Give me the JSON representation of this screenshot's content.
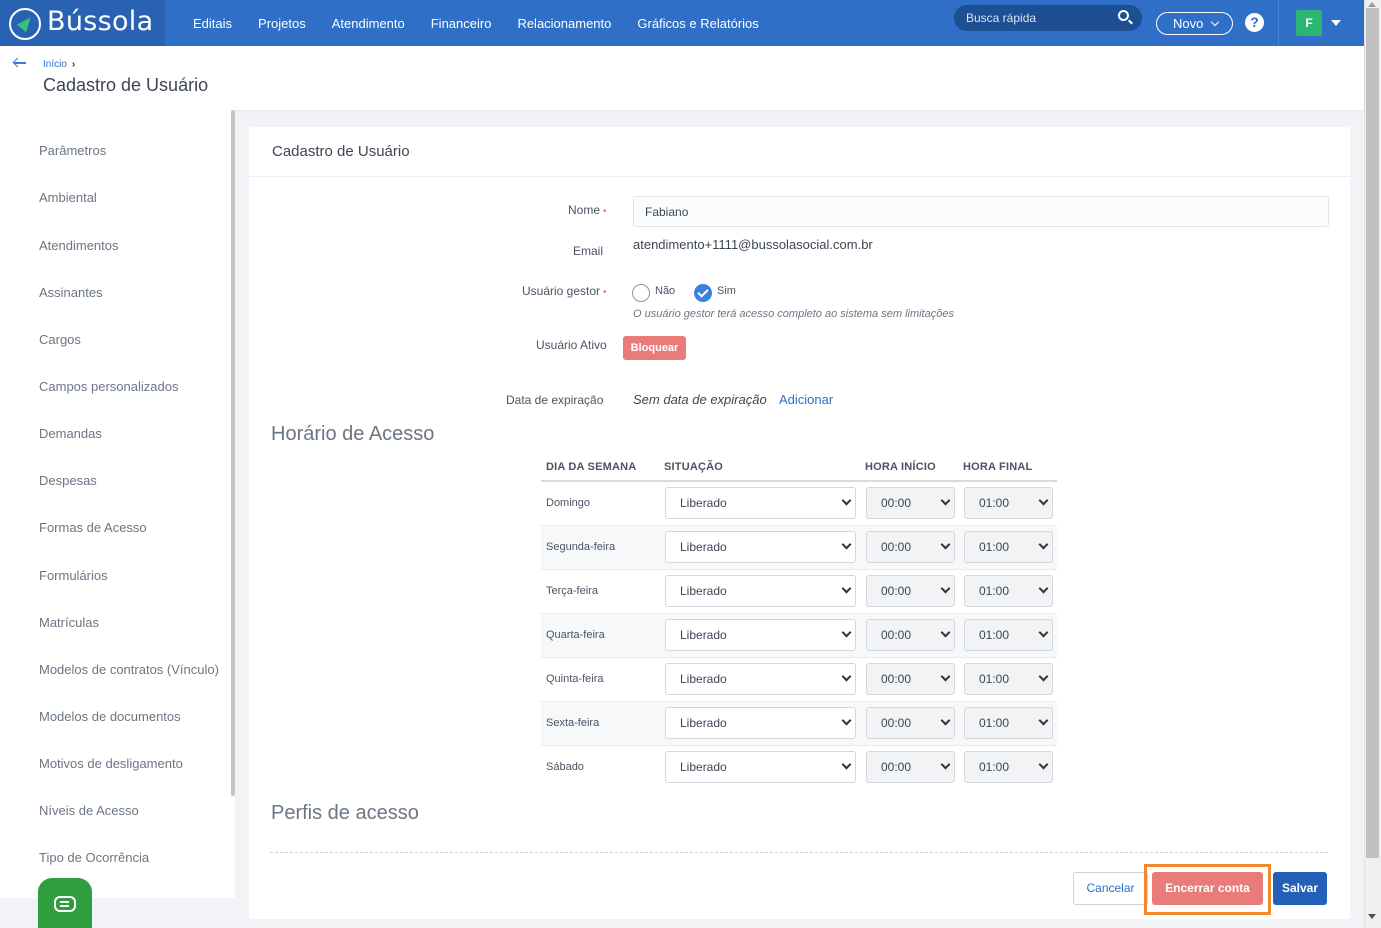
{
  "app": {
    "name": "Bússola"
  },
  "topnav": {
    "items": [
      "Editais",
      "Projetos",
      "Atendimento",
      "Financeiro",
      "Relacionamento",
      "Gráficos e Relatórios"
    ],
    "search_placeholder": "Busca rápida",
    "novo_label": "Novo",
    "help_label": "?",
    "avatar_letter": "F"
  },
  "header": {
    "breadcrumb": "Início",
    "breadcrumb_sep": "›",
    "title": "Cadastro de Usuário"
  },
  "sidebar": {
    "items": [
      "Parâmetros",
      "Ambiental",
      "Atendimentos",
      "Assinantes",
      "Cargos",
      "Campos personalizados",
      "Demandas",
      "Despesas",
      "Formas de Acesso",
      "Formulários",
      "Matrículas",
      "Modelos de contratos (Vínculo)",
      "Modelos de documentos",
      "Motivos de desligamento",
      "Níveis de Acesso",
      "Tipo de Ocorrência"
    ]
  },
  "form": {
    "card_title": "Cadastro de Usuário",
    "name_label": "Nome",
    "name_value": "Fabiano",
    "email_label": "Email",
    "email_value": "atendimento+1111@bussolasocial.com.br",
    "manager_label": "Usuário gestor",
    "manager_no": "Não",
    "manager_yes": "Sim",
    "manager_selected": "Sim",
    "manager_hint": "O usuário gestor terá acesso completo ao sistema sem limitações",
    "active_label": "Usuário Ativo",
    "block_label": "Bloquear",
    "expiration_label": "Data de expiração",
    "expiration_value": "Sem data de expiração",
    "expiration_add": "Adicionar",
    "required_mark": "•"
  },
  "schedule": {
    "title": "Horário de Acesso",
    "headers": [
      "DIA DA SEMANA",
      "SITUAÇÃO",
      "HORA INÍCIO",
      "HORA FINAL"
    ],
    "rows": [
      {
        "day": "Domingo",
        "status": "Liberado",
        "start": "00:00",
        "end": "01:00"
      },
      {
        "day": "Segunda-feira",
        "status": "Liberado",
        "start": "00:00",
        "end": "01:00"
      },
      {
        "day": "Terça-feira",
        "status": "Liberado",
        "start": "00:00",
        "end": "01:00"
      },
      {
        "day": "Quarta-feira",
        "status": "Liberado",
        "start": "00:00",
        "end": "01:00"
      },
      {
        "day": "Quinta-feira",
        "status": "Liberado",
        "start": "00:00",
        "end": "01:00"
      },
      {
        "day": "Sexta-feira",
        "status": "Liberado",
        "start": "00:00",
        "end": "01:00"
      },
      {
        "day": "Sábado",
        "status": "Liberado",
        "start": "00:00",
        "end": "01:00"
      }
    ]
  },
  "profiles": {
    "title": "Perfis de acesso"
  },
  "actions": {
    "cancel": "Cancelar",
    "end_account": "Encerrar conta",
    "save": "Salvar"
  },
  "colors": {
    "topbar": "#2f6fc7",
    "danger": "#ea7b7b",
    "primary": "#2460b9",
    "highlight": "#f08a2c",
    "chat": "#2e9e3e"
  }
}
